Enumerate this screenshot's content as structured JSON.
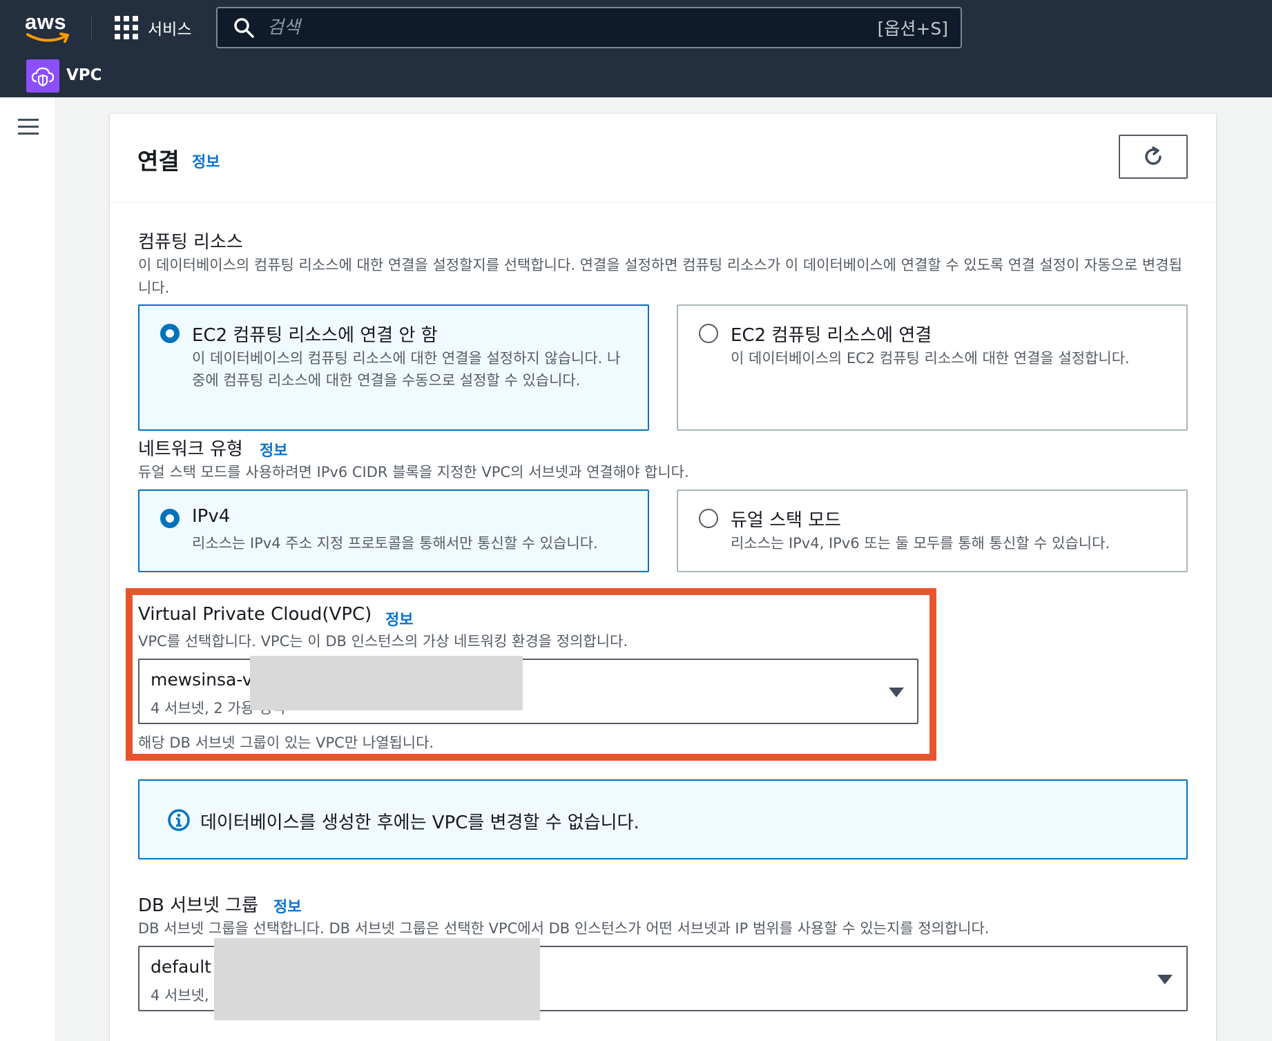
{
  "topnav": {
    "logo_text": "aws",
    "services_label": "서비스",
    "search_placeholder": "검색",
    "search_shortcut": "[옵션+S]",
    "service_name": "VPC"
  },
  "panel": {
    "title": "연결",
    "info": "정보"
  },
  "compute": {
    "label": "컴퓨팅 리소스",
    "description": "이 데이터베이스의 컴퓨팅 리소스에 대한 연결을 설정할지를 선택합니다. 연결을 설정하면 컴퓨팅 리소스가 이 데이터베이스에 연결할 수 있도록 연결 설정이 자동으로 변경됩니다.",
    "options": [
      {
        "title": "EC2 컴퓨팅 리소스에 연결 안 함",
        "description": "이 데이터베이스의 컴퓨팅 리소스에 대한 연결을 설정하지 않습니다. 나중에 컴퓨팅 리소스에 대한 연결을 수동으로 설정할 수 있습니다.",
        "selected": true
      },
      {
        "title": "EC2 컴퓨팅 리소스에 연결",
        "description": "이 데이터베이스의 EC2 컴퓨팅 리소스에 대한 연결을 설정합니다.",
        "selected": false
      }
    ]
  },
  "network": {
    "label": "네트워크 유형",
    "info": "정보",
    "description": "듀얼 스택 모드를 사용하려면 IPv6 CIDR 블록을 지정한 VPC의 서브넷과 연결해야 합니다.",
    "options": [
      {
        "title": "IPv4",
        "description": "리소스는 IPv4 주소 지정 프로토콜을 통해서만 통신할 수 있습니다.",
        "selected": true
      },
      {
        "title": "듀얼 스택 모드",
        "description": "리소스는 IPv4, IPv6 또는 둘 모두를 통해 통신할 수 있습니다.",
        "selected": false
      }
    ]
  },
  "vpc": {
    "label": "Virtual Private Cloud(VPC)",
    "info": "정보",
    "description": "VPC를 선택합니다. VPC는 이 DB 인스턴스의 가상 네트워킹 환경을 정의합니다.",
    "selected_value": "mewsinsa-v",
    "selected_sub": "4 서브넷, 2 가용 영역",
    "constraint": "해당 DB 서브넷 그룹이 있는 VPC만 나열됩니다."
  },
  "alert": {
    "text": "데이터베이스를 생성한 후에는 VPC를 변경할 수 없습니다."
  },
  "subnet_group": {
    "label": "DB 서브넷 그룹",
    "info": "정보",
    "description": "DB 서브넷 그룹을 선택합니다. DB 서브넷 그룹은 선택한 VPC에서 DB 인스턴스가 어떤 서브넷과 IP 범위를 사용할 수 있는지를 정의합니다.",
    "selected_value": "default",
    "selected_sub": "4 서브넷,"
  },
  "colors": {
    "nav_bg": "#232f3e",
    "accent": "#0073bb",
    "link": "#0972d3",
    "highlight": "#e9542d",
    "vpc_icon": "#8c4fff"
  }
}
